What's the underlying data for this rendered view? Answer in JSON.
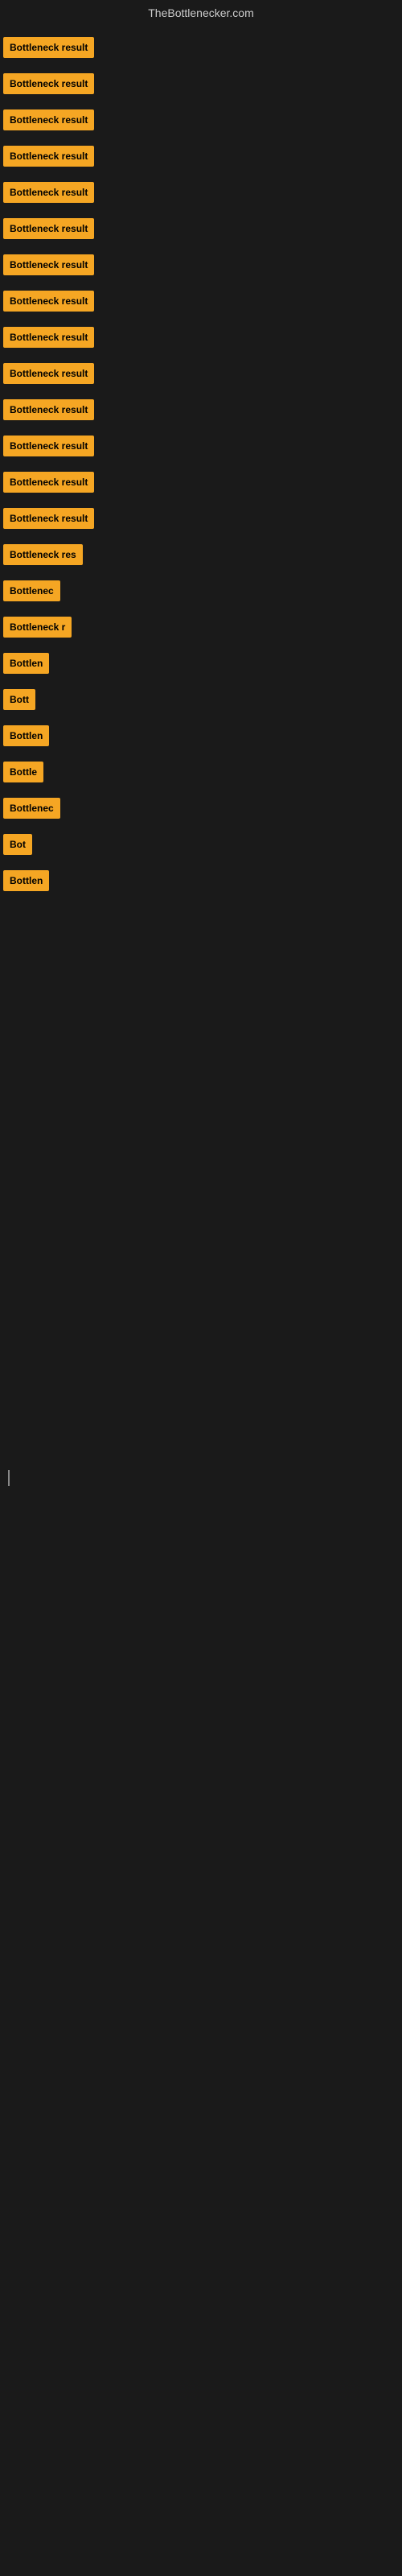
{
  "site": {
    "title": "TheBottlenecker.com"
  },
  "items": [
    {
      "id": 1,
      "label": "Bottleneck result",
      "width": "full"
    },
    {
      "id": 2,
      "label": "Bottleneck result",
      "width": "full"
    },
    {
      "id": 3,
      "label": "Bottleneck result",
      "width": "full"
    },
    {
      "id": 4,
      "label": "Bottleneck result",
      "width": "full"
    },
    {
      "id": 5,
      "label": "Bottleneck result",
      "width": "full"
    },
    {
      "id": 6,
      "label": "Bottleneck result",
      "width": "full"
    },
    {
      "id": 7,
      "label": "Bottleneck result",
      "width": "full"
    },
    {
      "id": 8,
      "label": "Bottleneck result",
      "width": "full"
    },
    {
      "id": 9,
      "label": "Bottleneck result",
      "width": "full"
    },
    {
      "id": 10,
      "label": "Bottleneck result",
      "width": "full"
    },
    {
      "id": 11,
      "label": "Bottleneck result",
      "width": "full"
    },
    {
      "id": 12,
      "label": "Bottleneck result",
      "width": "full"
    },
    {
      "id": 13,
      "label": "Bottleneck result",
      "width": "full"
    },
    {
      "id": 14,
      "label": "Bottleneck result",
      "width": "full"
    },
    {
      "id": 15,
      "label": "Bottleneck res",
      "width": "partial"
    },
    {
      "id": 16,
      "label": "Bottlenec",
      "width": "shorter"
    },
    {
      "id": 17,
      "label": "Bottleneck r",
      "width": "partial2"
    },
    {
      "id": 18,
      "label": "Bottlen",
      "width": "short"
    },
    {
      "id": 19,
      "label": "Bott",
      "width": "tiny"
    },
    {
      "id": 20,
      "label": "Bottlen",
      "width": "short"
    },
    {
      "id": 21,
      "label": "Bottle",
      "width": "shorter2"
    },
    {
      "id": 22,
      "label": "Bottlenec",
      "width": "shorter"
    },
    {
      "id": 23,
      "label": "Bot",
      "width": "tiny2"
    },
    {
      "id": 24,
      "label": "Bottlen",
      "width": "short"
    }
  ]
}
